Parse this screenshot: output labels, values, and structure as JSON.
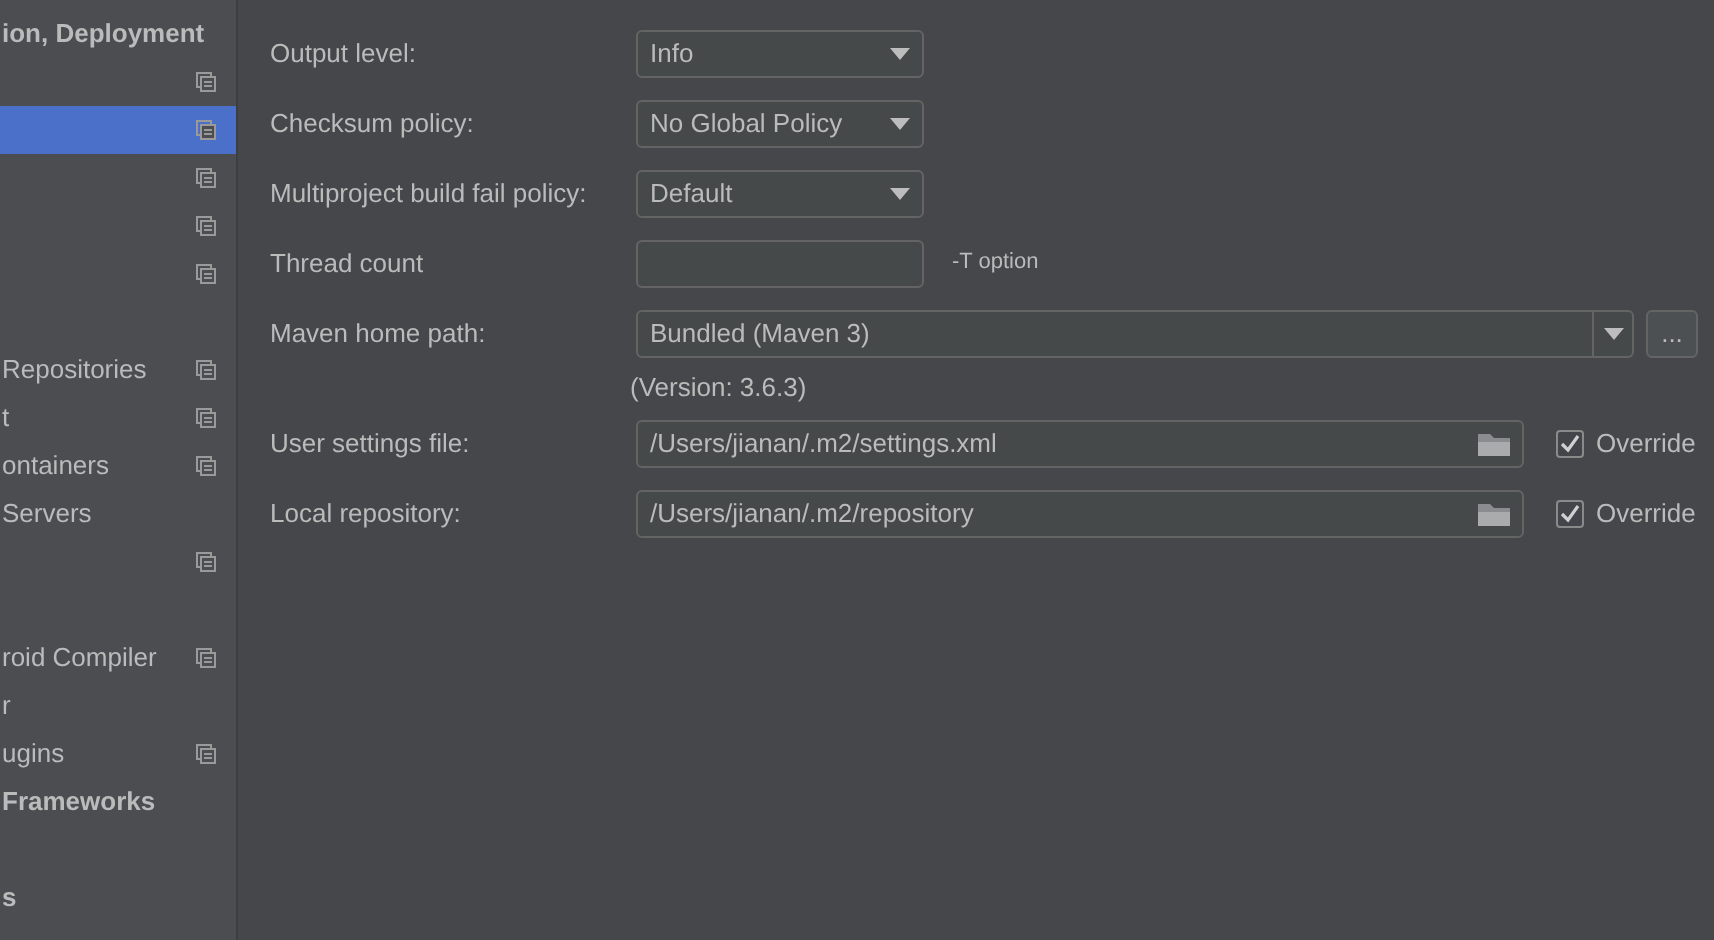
{
  "sidebar": {
    "items": [
      {
        "kind": "header",
        "label": "ion, Deployment",
        "copy_icon": false,
        "selected": false
      },
      {
        "kind": "item",
        "copy_icon": true,
        "selected": false
      },
      {
        "kind": "item",
        "copy_icon": true,
        "selected": true
      },
      {
        "kind": "item",
        "copy_icon": true,
        "selected": false
      },
      {
        "kind": "item",
        "copy_icon": true,
        "selected": false
      },
      {
        "kind": "item",
        "copy_icon": true,
        "selected": false
      },
      {
        "kind": "spacer"
      },
      {
        "kind": "item",
        "label": "Repositories",
        "copy_icon": true,
        "selected": false
      },
      {
        "kind": "item",
        "label": "t",
        "copy_icon": true,
        "selected": false
      },
      {
        "kind": "item",
        "label": "ontainers",
        "copy_icon": true,
        "selected": false
      },
      {
        "kind": "item",
        "label": "Servers",
        "copy_icon": false,
        "selected": false
      },
      {
        "kind": "item",
        "copy_icon": true,
        "selected": false
      },
      {
        "kind": "spacer"
      },
      {
        "kind": "item",
        "label": "roid Compiler",
        "copy_icon": true,
        "selected": false
      },
      {
        "kind": "item",
        "label": "r",
        "copy_icon": false,
        "selected": false
      },
      {
        "kind": "item",
        "label": "ugins",
        "copy_icon": true,
        "selected": false
      },
      {
        "kind": "header",
        "label": "Frameworks",
        "copy_icon": false,
        "selected": false
      },
      {
        "kind": "spacer"
      },
      {
        "kind": "header",
        "label": "s",
        "copy_icon": false,
        "selected": false
      }
    ]
  },
  "settings": [
    {
      "kind": "dropdown",
      "label": "Output level:",
      "value": "Info"
    },
    {
      "kind": "dropdown",
      "label": "Checksum policy:",
      "value": "No Global Policy"
    },
    {
      "kind": "dropdown",
      "label": "Multiproject build fail policy:",
      "value": "Default"
    },
    {
      "kind": "text",
      "label": "Thread count",
      "hint": "-T option"
    },
    {
      "kind": "combo",
      "label": "Maven home path:",
      "value": "Bundled (Maven 3)",
      "button": "...",
      "note": "(Version: 3.6.3)"
    },
    {
      "kind": "path",
      "label": "User settings file:",
      "value": "/Users/jianan/.m2/settings.xml",
      "override": {
        "label": "Override",
        "checked": true
      }
    },
    {
      "kind": "path",
      "label": "Local repository:",
      "value": "/Users/jianan/.m2/repository",
      "override": {
        "label": "Override",
        "checked": true
      }
    }
  ]
}
